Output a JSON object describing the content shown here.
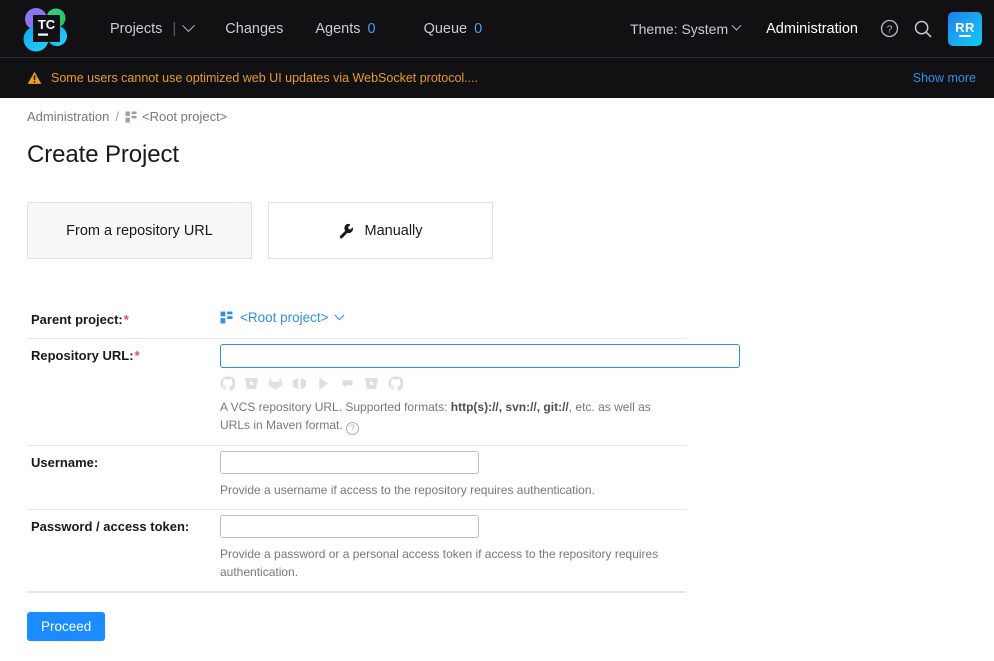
{
  "header": {
    "logo_text": "TC",
    "nav": [
      {
        "label": "Projects",
        "icon": "chevron-down-icon",
        "has_pipe": true
      },
      {
        "label": "Changes"
      },
      {
        "label": "Agents",
        "count": "0"
      },
      {
        "label": "Queue",
        "count": "0"
      }
    ],
    "theme_label": "Theme: System",
    "administration_label": "Administration",
    "help_icon": "question-circle-icon",
    "search_icon": "search-icon",
    "avatar_initials": "RR",
    "colors": {
      "header_bg": "#111114",
      "accent_blue": "#2e8fe8",
      "count_blue": "#4e9bff"
    }
  },
  "banner": {
    "icon": "warning-triangle-icon",
    "text": "Some users cannot use optimized web UI updates via WebSocket protocol....",
    "show_more_label": "Show more",
    "text_color": "#e89a24"
  },
  "breadcrumb": {
    "root_label": "Administration",
    "separator": "/",
    "current_icon": "project-grid-icon",
    "current_label": "<Root project>"
  },
  "page": {
    "title": "Create Project"
  },
  "tabs": [
    {
      "label": "From a repository URL",
      "icon": null,
      "selected": true
    },
    {
      "label": "Manually",
      "icon": "wrench-icon",
      "selected": false
    }
  ],
  "form": {
    "parent_project": {
      "label": "Parent project:",
      "required": true,
      "icon": "project-grid-icon",
      "value": "<Root project>",
      "chevron": "chevron-down-icon"
    },
    "repository_url": {
      "label": "Repository URL:",
      "required": true,
      "value": "",
      "placeholder": "",
      "vcs_icons": [
        "github-icon",
        "bitbucket-icon",
        "gitlab-icon",
        "azure-devops-icon",
        "perforce-icon",
        "mercurial-icon",
        "bitbucket-server-icon",
        "github-enterprise-icon"
      ],
      "help_prefix": "A VCS repository URL. Supported formats: ",
      "help_bold": "http(s)://, svn://, git://",
      "help_suffix": ", etc. as well as URLs in Maven format.",
      "help_icon": "question-circle-icon"
    },
    "username": {
      "label": "Username:",
      "required": false,
      "value": "",
      "placeholder": "",
      "help": "Provide a username if access to the repository requires authentication."
    },
    "password": {
      "label": "Password / access token:",
      "required": false,
      "value": "",
      "placeholder": "",
      "help": "Provide a password or a personal access token if access to the repository requires authentication."
    },
    "required_marker": "*"
  },
  "actions": {
    "proceed_label": "Proceed",
    "proceed_color": "#1a8cff"
  }
}
